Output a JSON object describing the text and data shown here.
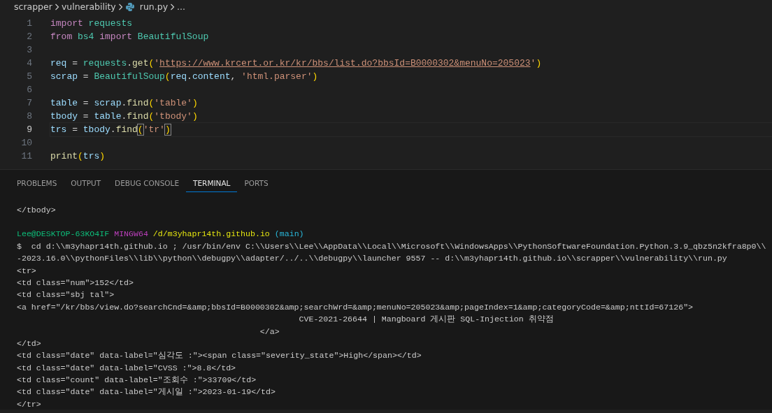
{
  "breadcrumb": [
    {
      "label": "scrapper",
      "kind": "folder"
    },
    {
      "label": "vulnerability",
      "kind": "folder"
    },
    {
      "label": "run.py",
      "kind": "file"
    },
    {
      "label": "...",
      "kind": "more"
    }
  ],
  "editor": {
    "lines": [
      {
        "number": "1",
        "current": false,
        "tokens": [
          {
            "t": "import ",
            "kind": "kw"
          },
          {
            "t": "requests",
            "kind": "mod"
          }
        ]
      },
      {
        "number": "2",
        "current": false,
        "tokens": [
          {
            "t": "from ",
            "kind": "kw"
          },
          {
            "t": "bs4 ",
            "kind": "mod"
          },
          {
            "t": "import ",
            "kind": "kw"
          },
          {
            "t": "BeautifulSoup",
            "kind": "mod"
          }
        ]
      },
      {
        "number": "3",
        "current": false
      },
      {
        "number": "4",
        "current": false,
        "tokens": [
          {
            "t": "req",
            "kind": "var"
          },
          {
            "t": " = ",
            "kind": "punc"
          },
          {
            "t": "requests",
            "kind": "mod"
          },
          {
            "t": ".",
            "kind": "punc"
          },
          {
            "t": "get",
            "kind": "fn"
          },
          {
            "t": "(",
            "kind": "bracket"
          },
          {
            "t": "'",
            "kind": "str"
          },
          {
            "t": "https://www.krcert.or.kr/kr/bbs/list.do?bbsId=B0000302&menuNo=205023",
            "kind": "url"
          },
          {
            "t": "'",
            "kind": "str"
          },
          {
            "t": ")",
            "kind": "bracket"
          }
        ]
      },
      {
        "number": "5",
        "current": false,
        "tokens": [
          {
            "t": "scrap",
            "kind": "var"
          },
          {
            "t": " = ",
            "kind": "punc"
          },
          {
            "t": "BeautifulSoup",
            "kind": "mod"
          },
          {
            "t": "(",
            "kind": "bracket"
          },
          {
            "t": "req",
            "kind": "var"
          },
          {
            "t": ".",
            "kind": "punc"
          },
          {
            "t": "content",
            "kind": "var"
          },
          {
            "t": ", ",
            "kind": "punc"
          },
          {
            "t": "'html.parser'",
            "kind": "str"
          },
          {
            "t": ")",
            "kind": "bracket"
          }
        ]
      },
      {
        "number": "6",
        "current": false
      },
      {
        "number": "7",
        "current": false,
        "tokens": [
          {
            "t": "table",
            "kind": "var"
          },
          {
            "t": " = ",
            "kind": "punc"
          },
          {
            "t": "scrap",
            "kind": "var"
          },
          {
            "t": ".",
            "kind": "punc"
          },
          {
            "t": "find",
            "kind": "fn"
          },
          {
            "t": "(",
            "kind": "bracket"
          },
          {
            "t": "'table'",
            "kind": "str"
          },
          {
            "t": ")",
            "kind": "bracket"
          }
        ]
      },
      {
        "number": "8",
        "current": false,
        "tokens": [
          {
            "t": "tbody",
            "kind": "var"
          },
          {
            "t": " = ",
            "kind": "punc"
          },
          {
            "t": "table",
            "kind": "var"
          },
          {
            "t": ".",
            "kind": "punc"
          },
          {
            "t": "find",
            "kind": "fn"
          },
          {
            "t": "(",
            "kind": "bracket"
          },
          {
            "t": "'tbody'",
            "kind": "str"
          },
          {
            "t": ")",
            "kind": "bracket"
          }
        ]
      },
      {
        "number": "9",
        "current": true,
        "tokens": [
          {
            "t": "trs",
            "kind": "var"
          },
          {
            "t": " = ",
            "kind": "punc"
          },
          {
            "t": "tbody",
            "kind": "var"
          },
          {
            "t": ".",
            "kind": "punc"
          },
          {
            "t": "find",
            "kind": "fn"
          },
          {
            "t": "(",
            "kind": "match"
          },
          {
            "t": "'tr'",
            "kind": "str"
          },
          {
            "t": ")",
            "kind": "match"
          }
        ]
      },
      {
        "number": "10",
        "current": false
      },
      {
        "number": "11",
        "current": false,
        "tokens": [
          {
            "t": "print",
            "kind": "fn"
          },
          {
            "t": "(",
            "kind": "bracket"
          },
          {
            "t": "trs",
            "kind": "var"
          },
          {
            "t": ")",
            "kind": "bracket"
          }
        ]
      }
    ]
  },
  "panel_tabs": [
    {
      "label": "PROBLEMS",
      "selected": false
    },
    {
      "label": "OUTPUT",
      "selected": false
    },
    {
      "label": "DEBUG CONSOLE",
      "selected": false
    },
    {
      "label": "TERMINAL",
      "selected": true
    },
    {
      "label": "PORTS",
      "selected": false
    }
  ],
  "terminal": {
    "blocks": [
      {
        "lines": [
          {
            "segments": [
              {
                "t": "</tbody>",
                "kind": "plain"
              }
            ]
          }
        ]
      },
      {
        "lines": [
          {
            "segments": [
              {
                "t": "Lee@DESKTOP-63KO4IF",
                "kind": "user"
              },
              {
                "t": "MINGW64",
                "kind": "system"
              },
              {
                "t": "/d/m3yhapr14th.github.io",
                "kind": "path"
              },
              {
                "t": "(main)",
                "kind": "branch"
              }
            ]
          },
          {
            "segments": [
              {
                "t": "$  cd d:\\\\m3yhapr14th.github.io ; /usr/bin/env C:\\\\Users\\\\Lee\\\\AppData\\\\Local\\\\Microsoft\\\\WindowsApps\\\\PythonSoftwareFoundation.Python.3.9_qbz5n2kfra8p0\\\\",
                "kind": "plain"
              }
            ]
          },
          {
            "segments": [
              {
                "t": "-2023.16.0\\\\pythonFiles\\\\lib\\\\python\\\\debugpy\\\\adapter/../..\\\\debugpy\\\\launcher 9557 -- d:\\\\m3yhapr14th.github.io\\\\scrapper\\\\vulnerability\\\\run.py",
                "kind": "plain"
              }
            ]
          },
          {
            "segments": [
              {
                "t": "<tr>",
                "kind": "plain"
              }
            ]
          },
          {
            "segments": [
              {
                "t": "<td class=\"num\">152</td>",
                "kind": "plain"
              }
            ]
          },
          {
            "segments": [
              {
                "t": "<td class=\"sbj tal\">",
                "kind": "plain"
              }
            ]
          },
          {
            "segments": [
              {
                "t": "<a href=\"/kr/bbs/view.do?searchCnd=&amp;bbsId=B0000302&amp;searchWrd=&amp;menuNo=205023&amp;pageIndex=1&amp;categoryCode=&amp;nttId=67126\">",
                "kind": "plain"
              }
            ]
          },
          {
            "segments": [
              {
                "t": "                                                          CVE-2021-26644 | Mangboard 게시판 SQL-Injection 취약점",
                "kind": "plain"
              }
            ]
          },
          {
            "segments": [
              {
                "t": "                                                  </a>",
                "kind": "plain"
              }
            ]
          },
          {
            "segments": [
              {
                "t": "</td>",
                "kind": "plain"
              }
            ]
          },
          {
            "segments": [
              {
                "t": "<td class=\"date\" data-label=\"심각도 :\"><span class=\"severity_state\">High</span></td>",
                "kind": "plain"
              }
            ]
          },
          {
            "segments": [
              {
                "t": "<td class=\"date\" data-label=\"CVSS :\">8.8</td>",
                "kind": "plain"
              }
            ]
          },
          {
            "segments": [
              {
                "t": "<td class=\"count\" data-label=\"조회수 :\">33709</td>",
                "kind": "plain"
              }
            ]
          },
          {
            "segments": [
              {
                "t": "<td class=\"date\" data-label=\"게시일 :\">2023-01-19</td>",
                "kind": "plain"
              }
            ]
          },
          {
            "segments": [
              {
                "t": "</tr>",
                "kind": "plain"
              }
            ]
          }
        ]
      }
    ]
  }
}
